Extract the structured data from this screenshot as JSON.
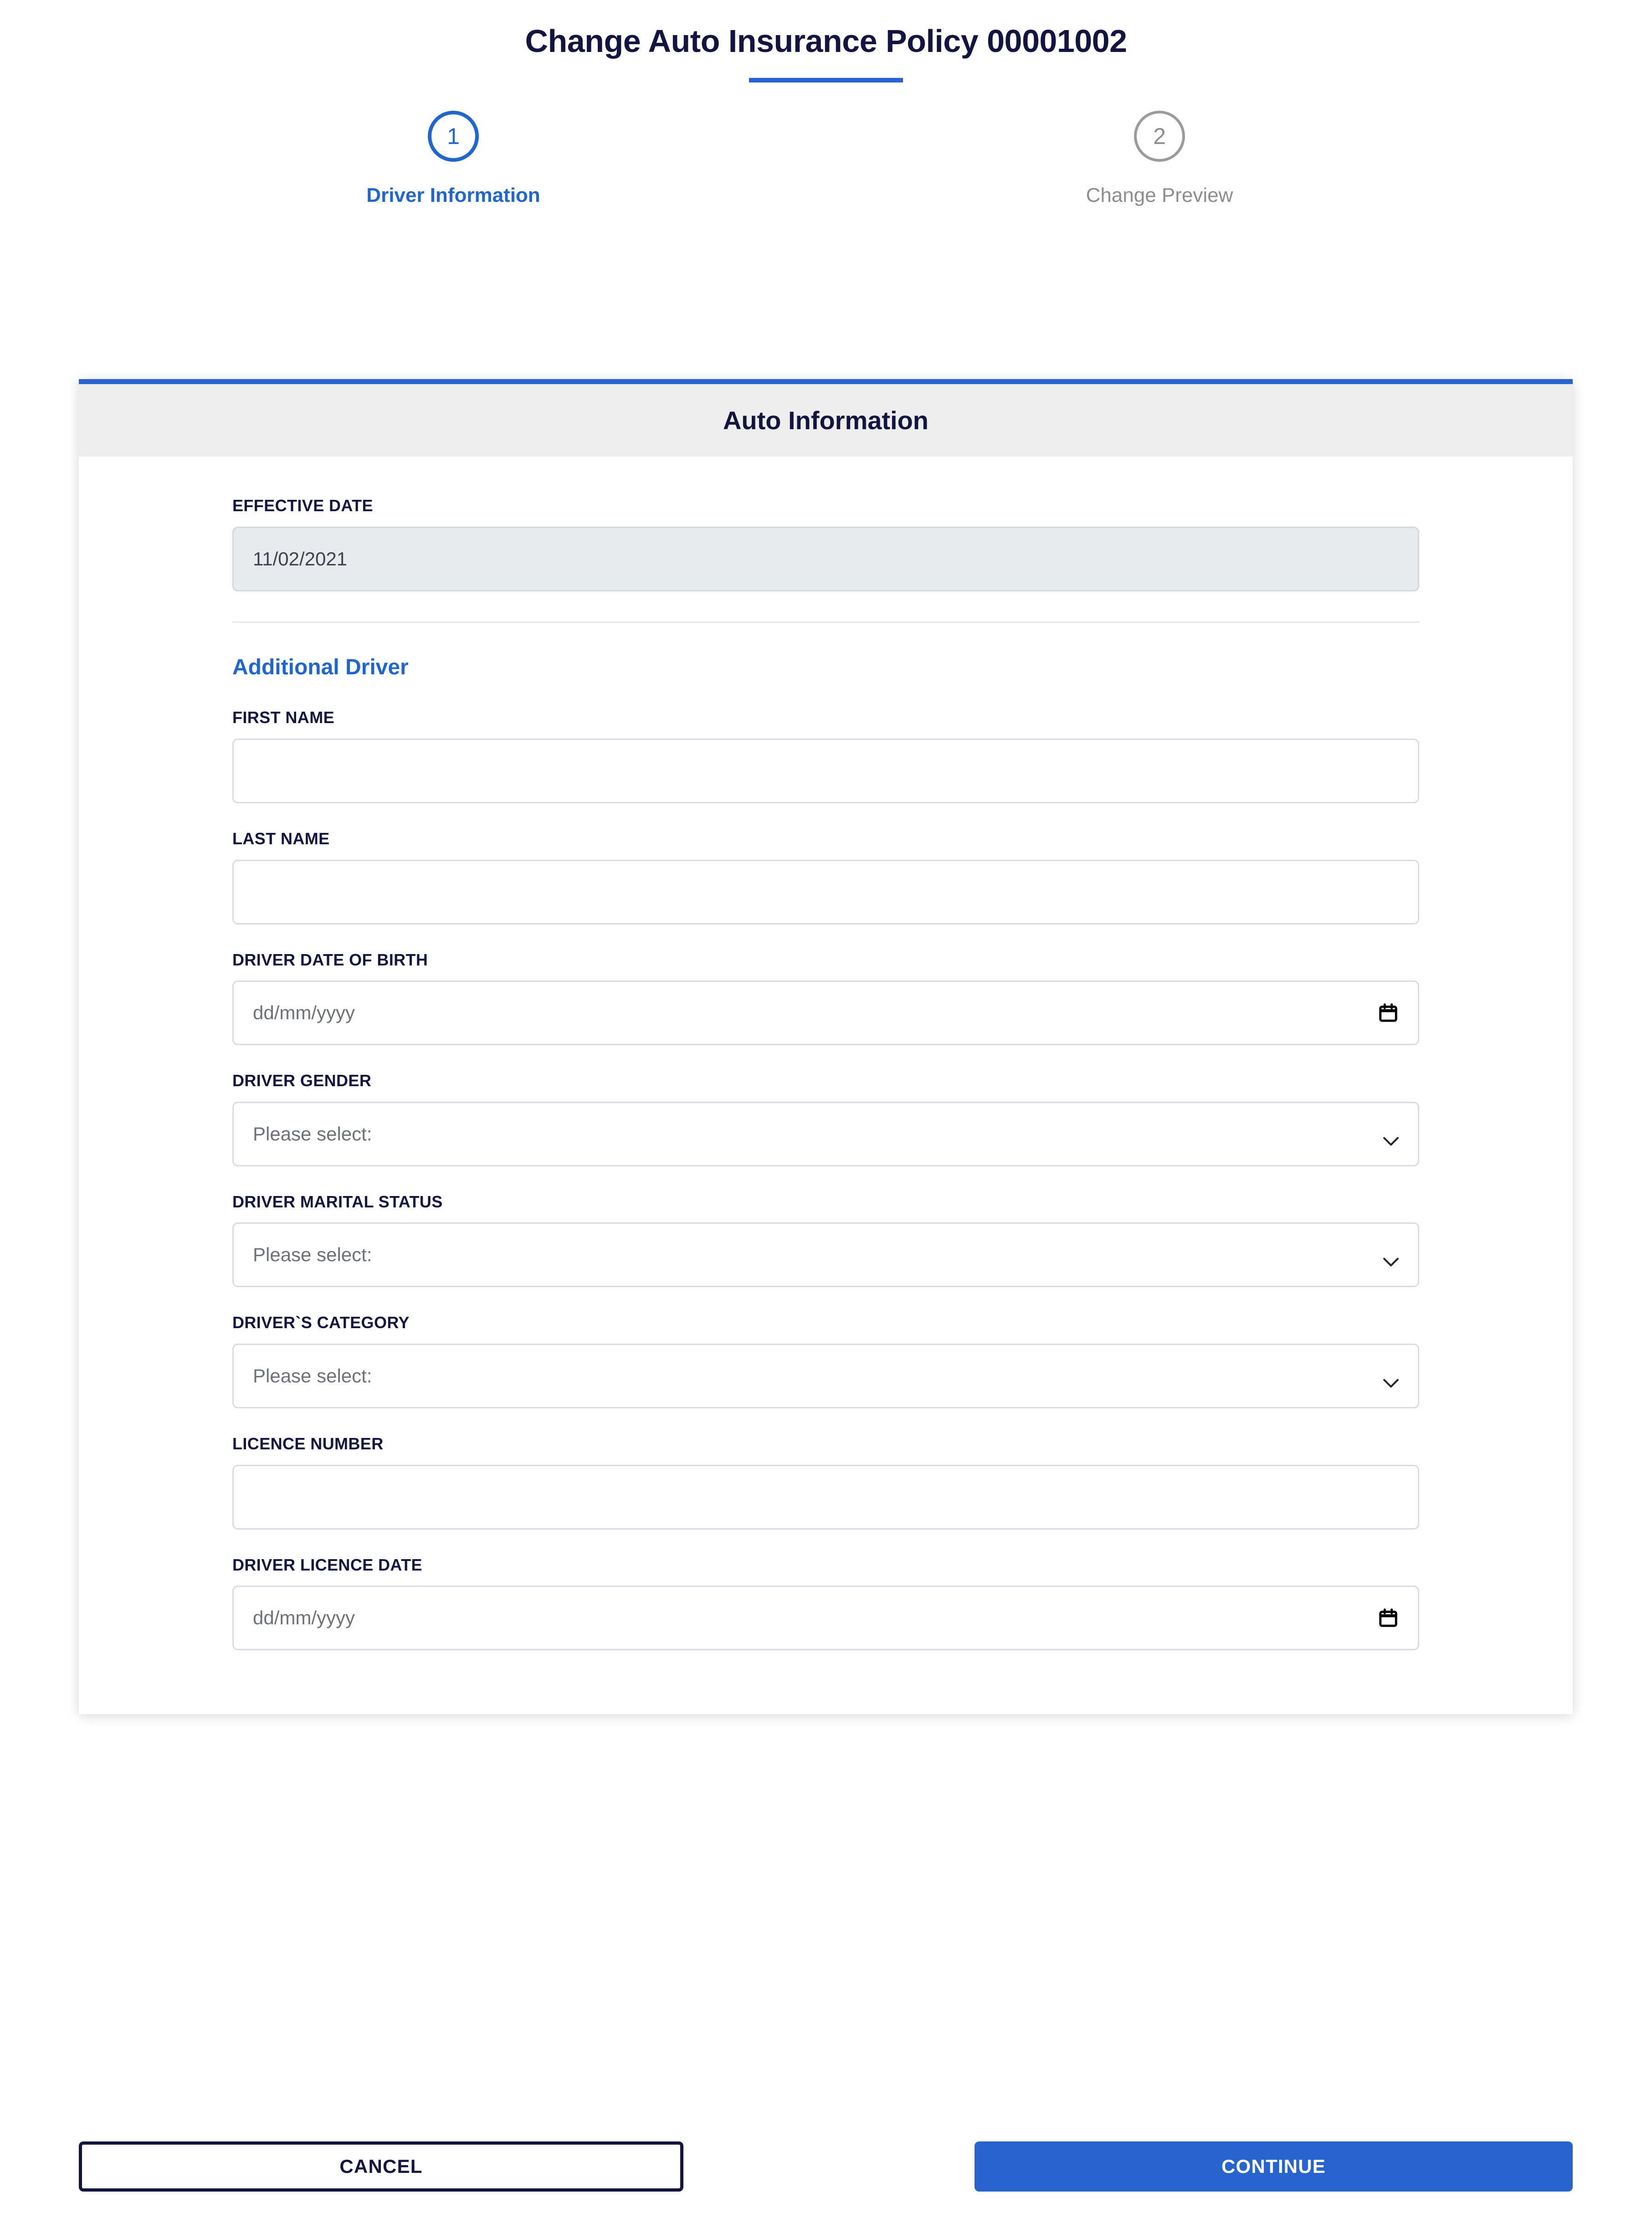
{
  "page": {
    "title": "Change Auto Insurance Policy 00001002",
    "accent_color": "#2764cd",
    "heading_color": "#131440"
  },
  "stepper": {
    "steps": [
      {
        "number": "1",
        "label": "Driver Information",
        "state": "active"
      },
      {
        "number": "2",
        "label": "Change Preview",
        "state": "inactive"
      }
    ]
  },
  "card": {
    "header_title": "Auto Information",
    "effective_date": {
      "label": "EFFECTIVE DATE",
      "value": "11/02/2021",
      "disabled": true
    },
    "section": {
      "heading": "Additional Driver"
    },
    "fields": [
      {
        "id": "first-name",
        "label": "FIRST NAME",
        "type": "text",
        "value": "",
        "placeholder": ""
      },
      {
        "id": "last-name",
        "label": "LAST NAME",
        "type": "text",
        "value": "",
        "placeholder": ""
      },
      {
        "id": "driver-date-of-birth",
        "label": "DRIVER DATE OF BIRTH",
        "type": "date",
        "value": "",
        "placeholder": "dd/mm/yyyy"
      },
      {
        "id": "driver-gender",
        "label": "DRIVER GENDER",
        "type": "select",
        "value": "Please select:",
        "placeholder": "Please select:"
      },
      {
        "id": "driver-marital-status",
        "label": "DRIVER MARITAL STATUS",
        "type": "select",
        "value": "Please select:",
        "placeholder": "Please select:"
      },
      {
        "id": "drivers-category",
        "label": "DRIVER`S CATEGORY",
        "type": "select",
        "value": "Please select:",
        "placeholder": "Please select:"
      },
      {
        "id": "licence-number",
        "label": "LICENCE NUMBER",
        "type": "text",
        "value": "",
        "placeholder": ""
      },
      {
        "id": "driver-licence-date",
        "label": "DRIVER LICENCE DATE",
        "type": "date",
        "value": "",
        "placeholder": "dd/mm/yyyy"
      }
    ]
  },
  "footer": {
    "cancel_label": "CANCEL",
    "continue_label": "CONTINUE"
  }
}
